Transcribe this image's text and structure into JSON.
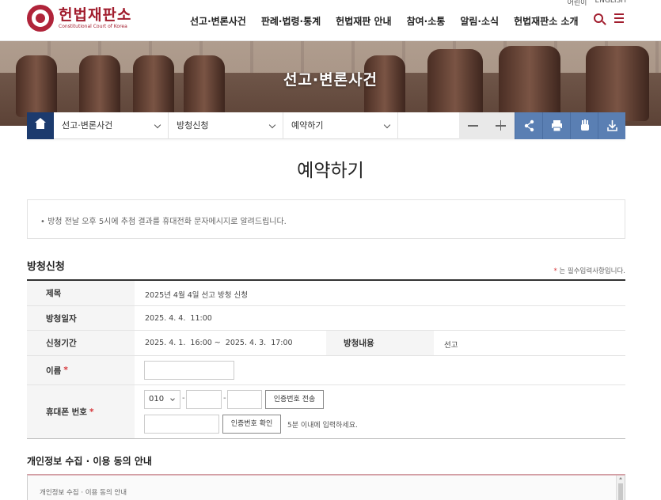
{
  "header": {
    "logo_main": "헌법재판소",
    "logo_sub": "Constitutional Court of Korea",
    "utility_links": [
      "어린이",
      "ENGLISH"
    ],
    "nav": [
      "선고·변론사건",
      "판례·법령·통계",
      "헌법재판 안내",
      "참여·소통",
      "알림·소식",
      "헌법재판소 소개"
    ]
  },
  "banner": {
    "title": "선고·변론사건"
  },
  "location": {
    "crumbs": [
      "선고·변론사건",
      "방청신청",
      "예약하기"
    ]
  },
  "page": {
    "title": "예약하기"
  },
  "notice": {
    "text": "• 방청 전날 오후 5시에 추첨 결과를 휴대전화 문자메시지로 알려드립니다."
  },
  "form": {
    "section_title": "방청신청",
    "required_star": "*",
    "required_note": " 는 필수입력사항입니다.",
    "rows": {
      "subject": {
        "label": "제목",
        "value": "2025년 4월 4일 선고 방청 신청"
      },
      "date": {
        "label": "방청일자",
        "value": "2025. 4. 4.  11:00"
      },
      "period": {
        "label": "신청기간",
        "value": "2025. 4. 1.  16:00 ~  2025. 4. 3.  17:00",
        "label2": "방청내용",
        "value2": "선고"
      },
      "name": {
        "label": "이름",
        "value": ""
      },
      "phone": {
        "label": "휴대폰 번호",
        "prefix": "010",
        "dash": "-",
        "send_button": "인증번호 전송",
        "confirm_button": "인증번호 확인",
        "hint": "5분 이내에 입력하세요."
      }
    }
  },
  "privacy": {
    "title": "개인정보 수집 · 이용 동의 안내",
    "box_text": "개인정보 수집 · 이용 동의 안내"
  },
  "colors": {
    "brand": "#a11c2d",
    "home": "#1c3b6e",
    "tool_blue": "#5a7fb3"
  }
}
